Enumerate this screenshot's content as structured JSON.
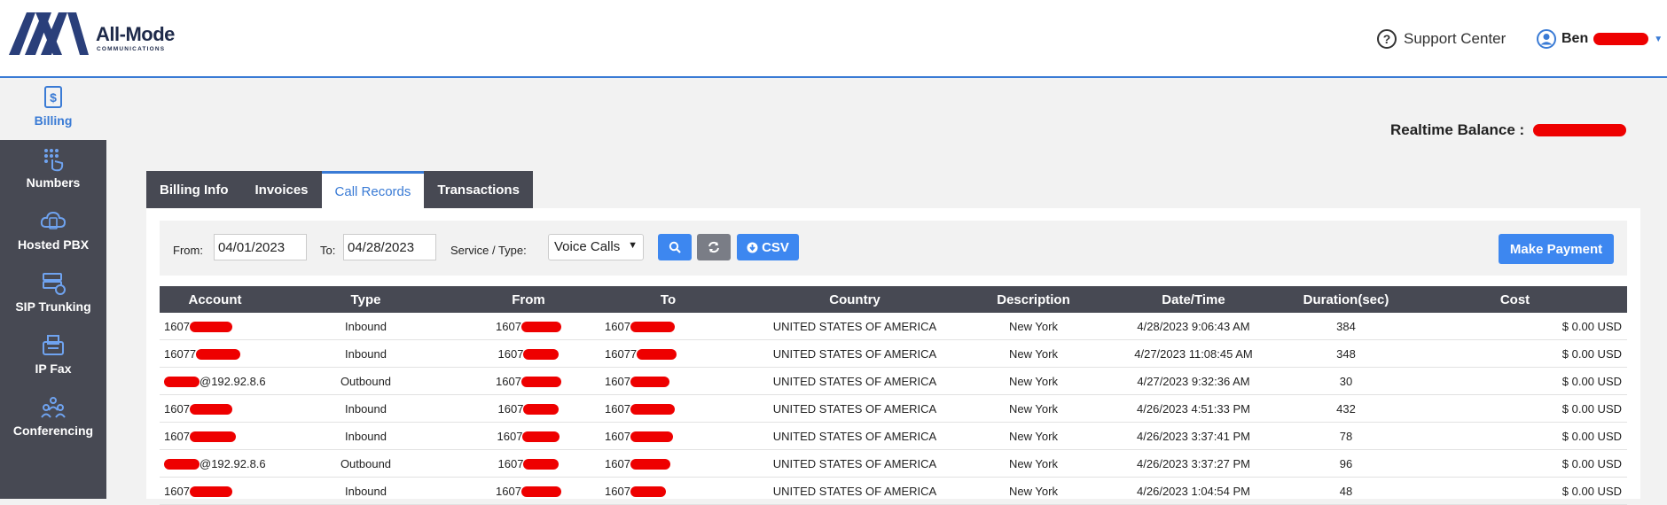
{
  "brand": {
    "name": "All-Mode",
    "sub": "COMMUNICATIONS"
  },
  "header": {
    "support_label": "Support Center",
    "user_name": "Ben"
  },
  "sidebar": {
    "items": [
      {
        "label": "Billing",
        "icon": "dollar-receipt-icon"
      },
      {
        "label": "Numbers",
        "icon": "keypad-hand-icon"
      },
      {
        "label": "Hosted PBX",
        "icon": "cloud-phone-icon"
      },
      {
        "label": "SIP Trunking",
        "icon": "server-icon"
      },
      {
        "label": "IP Fax",
        "icon": "fax-icon"
      },
      {
        "label": "Conferencing",
        "icon": "people-icon"
      }
    ]
  },
  "balance_label": "Realtime Balance :",
  "tabs": [
    {
      "label": "Billing Info"
    },
    {
      "label": "Invoices"
    },
    {
      "label": "Call Records"
    },
    {
      "label": "Transactions"
    }
  ],
  "filters": {
    "from_label": "From:",
    "from_value": "04/01/2023",
    "to_label": "To:",
    "to_value": "04/28/2023",
    "service_label": "Service / Type:",
    "service_value": "Voice Calls",
    "csv_label": "CSV",
    "pay_label": "Make Payment"
  },
  "table": {
    "headers": [
      "Account",
      "Type",
      "From",
      "To",
      "Country",
      "Description",
      "Date/Time",
      "Duration(sec)",
      "Cost"
    ],
    "rows": [
      {
        "account": "1607",
        "account_suffix": "",
        "type": "Inbound",
        "from": "1607",
        "to": "1607",
        "country": "UNITED STATES OF AMERICA",
        "description": "New York",
        "datetime": "4/28/2023 9:06:43 AM",
        "duration": "384",
        "cost": "$ 0.00 USD"
      },
      {
        "account": "16077",
        "account_suffix": "",
        "type": "Inbound",
        "from": "1607",
        "to": "16077",
        "country": "UNITED STATES OF AMERICA",
        "description": "New York",
        "datetime": "4/27/2023 11:08:45 AM",
        "duration": "348",
        "cost": "$ 0.00 USD"
      },
      {
        "account": "",
        "account_suffix": "@192.92.8.6",
        "type": "Outbound",
        "from": "1607",
        "to": "1607",
        "country": "UNITED STATES OF AMERICA",
        "description": "New York",
        "datetime": "4/27/2023 9:32:36 AM",
        "duration": "30",
        "cost": "$ 0.00 USD"
      },
      {
        "account": "1607",
        "account_suffix": "",
        "type": "Inbound",
        "from": "1607",
        "to": "1607",
        "country": "UNITED STATES OF AMERICA",
        "description": "New York",
        "datetime": "4/26/2023 4:51:33 PM",
        "duration": "432",
        "cost": "$ 0.00 USD"
      },
      {
        "account": "1607",
        "account_suffix": "",
        "type": "Inbound",
        "from": "1607",
        "to": "1607",
        "country": "UNITED STATES OF AMERICA",
        "description": "New York",
        "datetime": "4/26/2023 3:37:41 PM",
        "duration": "78",
        "cost": "$ 0.00 USD"
      },
      {
        "account": "",
        "account_suffix": "@192.92.8.6",
        "type": "Outbound",
        "from": "1607",
        "to": "1607",
        "country": "UNITED STATES OF AMERICA",
        "description": "New York",
        "datetime": "4/26/2023 3:37:27 PM",
        "duration": "96",
        "cost": "$ 0.00 USD"
      },
      {
        "account": "1607",
        "account_suffix": "",
        "type": "Inbound",
        "from": "1607",
        "to": "1607",
        "country": "UNITED STATES OF AMERICA",
        "description": "New York",
        "datetime": "4/26/2023 1:04:54 PM",
        "duration": "48",
        "cost": "$ 0.00 USD"
      }
    ]
  },
  "colors": {
    "accent": "#3a7bd5",
    "sidebar": "#474953",
    "button": "#3d87f0",
    "redaction": "#ee0000"
  }
}
